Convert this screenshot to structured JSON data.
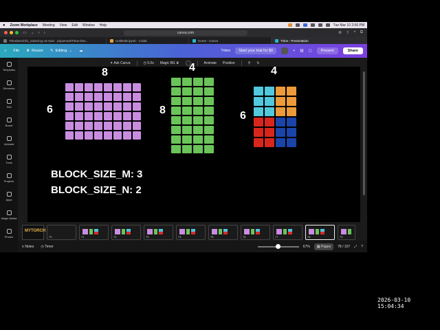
{
  "menubar": {
    "app": "Zoom Workplace",
    "items": [
      "Meeting",
      "View",
      "Edit",
      "Window",
      "Help"
    ],
    "clock": "Tue Mar 10  2:56 PM"
  },
  "browser": {
    "url": "canva.com",
    "tabs": [
      {
        "label": "Tritonbench/l1_naive/t.py at main · pnjoennat/Triton-ben..."
      },
      {
        "label": "Untitled8.ipynb - Colab"
      },
      {
        "label": "Home - Canva"
      },
      {
        "label": "Triton - Presentation",
        "active": true
      }
    ]
  },
  "canva": {
    "file": "File",
    "resize": "Resize",
    "editing": "Editing",
    "title": "Triton",
    "trial": "Start your trial for $0",
    "present": "Present",
    "share": "Share"
  },
  "sidebar": [
    "Templates",
    "Elements",
    "Text",
    "Brand",
    "Uploads",
    "Tools",
    "Projects",
    "Apps",
    "Magic Media",
    "Photos"
  ],
  "toolbar": {
    "ask": "Ask Canva",
    "duration": "5.0s",
    "magic_bg": "Magic BG",
    "animate": "Animate",
    "position": "Position"
  },
  "slide": {
    "left": {
      "top": "8",
      "side": "6",
      "rows": 6,
      "cols": 8,
      "color": "#c98de0"
    },
    "middle": {
      "top": "4",
      "side": "8",
      "rows": 8,
      "cols": 4,
      "color": "#6bc459"
    },
    "right": {
      "top": "4",
      "side": "6",
      "rows": 6,
      "cols": 4,
      "colors": {
        "tl": "#52c8dd",
        "tr": "#ec9a3a",
        "bl": "#d9261d",
        "br": "#1a44a8"
      }
    },
    "line1": "BLOCK_SIZE_M: 3",
    "line2": "BLOCK_SIZE_N: 2"
  },
  "pages": {
    "numbers": [
      "70",
      "71",
      "72",
      "73",
      "74",
      "75",
      "76",
      "77",
      "78",
      "79"
    ],
    "first_thumb": "MYTORCH",
    "selected": "78"
  },
  "footer": {
    "notes": "Notes",
    "timer": "Timer",
    "zoom": "67%",
    "pages_label": "Pages",
    "page_count": "78 / 107"
  },
  "timestamp": "2026-03-10  15:04:34"
}
